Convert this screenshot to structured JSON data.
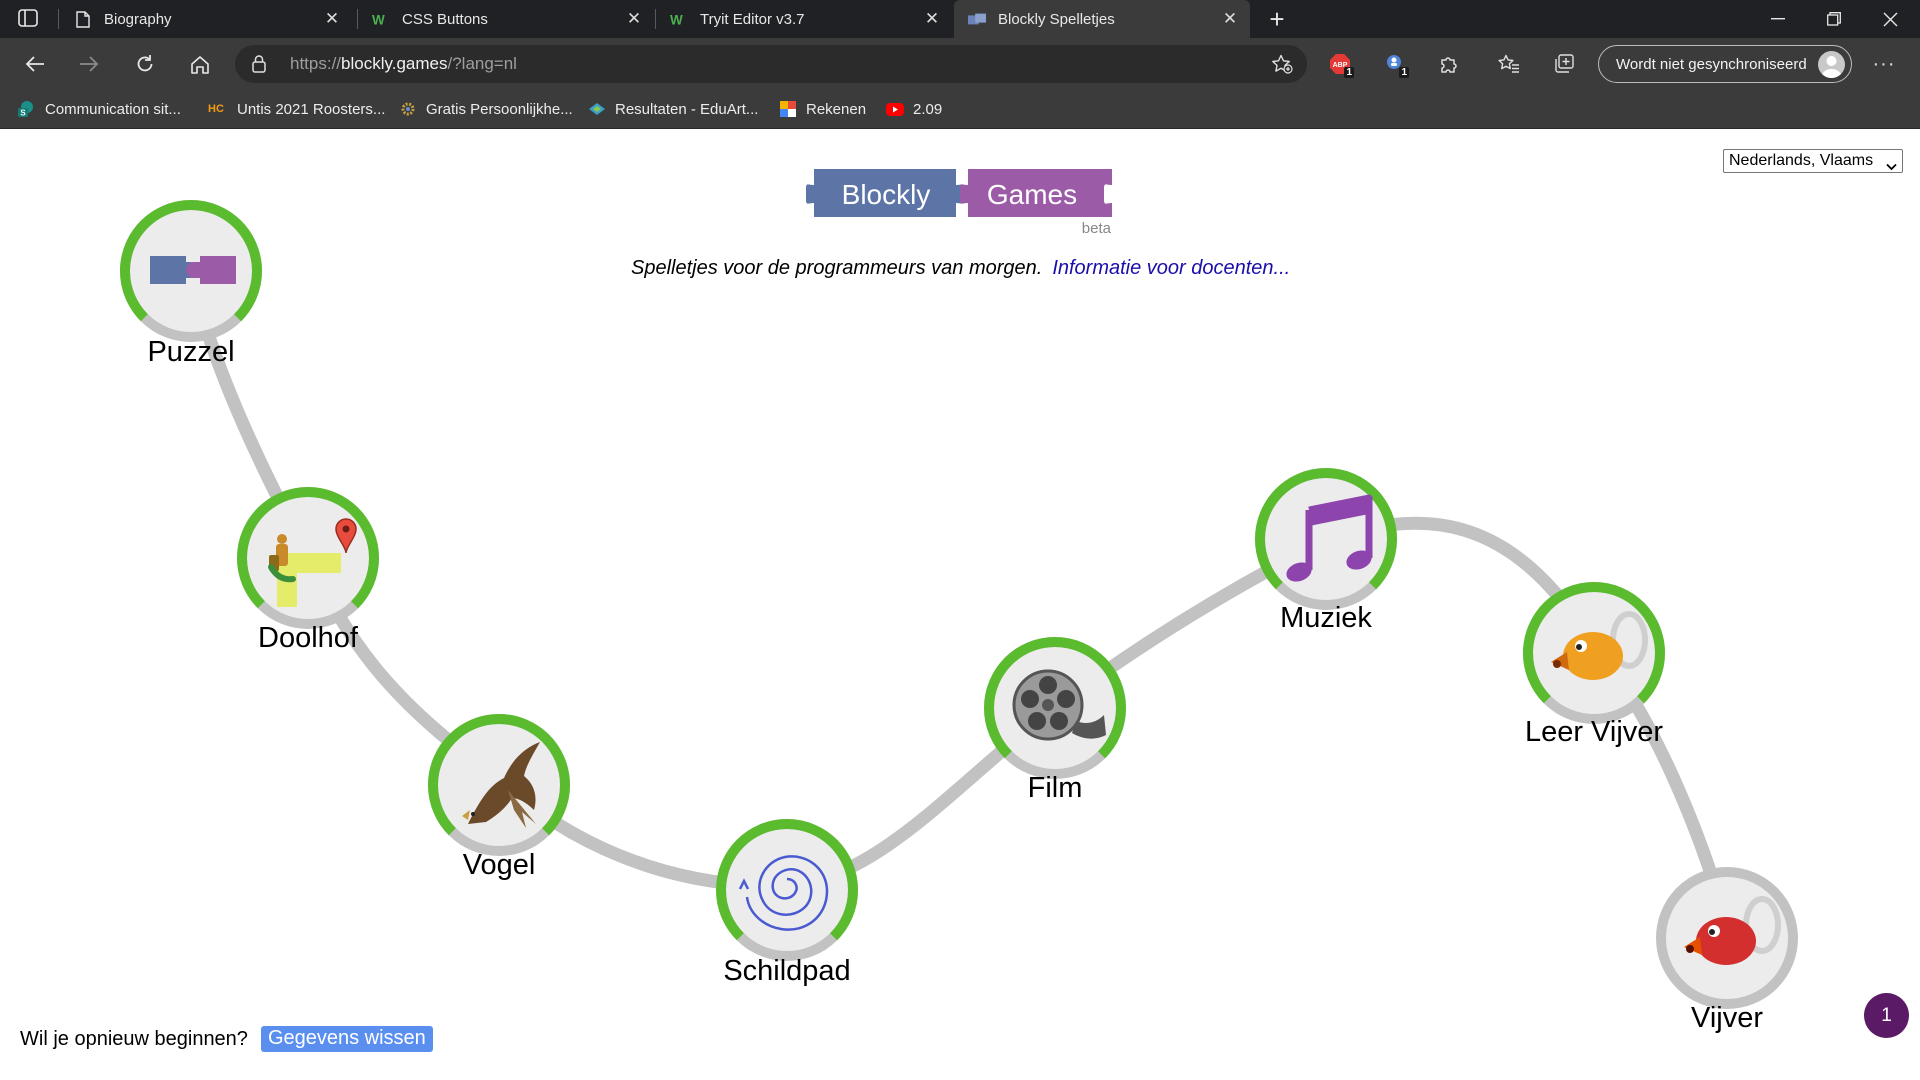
{
  "browser": {
    "tabs": [
      {
        "title": "Biography",
        "favicon": "page-icon"
      },
      {
        "title": "CSS Buttons",
        "favicon": "w3schools-icon"
      },
      {
        "title": "Tryit Editor v3.7",
        "favicon": "w3schools-icon"
      },
      {
        "title": "Blockly Spelletjes",
        "favicon": "blockly-icon",
        "active": true
      }
    ],
    "url_scheme": "https://",
    "url_host": "blockly.games",
    "url_path": "/?lang=nl",
    "extensions": [
      {
        "name": "adblock-icon",
        "badge": "1"
      },
      {
        "name": "extension-blue-icon",
        "badge": "1"
      }
    ],
    "sync_label": "Wordt niet gesynchroniseerd",
    "bookmarks": [
      {
        "label": "Communication sit...",
        "icon": "S"
      },
      {
        "label": "Untis 2021 Roosters...",
        "icon": "HC"
      },
      {
        "label": "Gratis Persoonlijkhe...",
        "icon": "gear"
      },
      {
        "label": "Resultaten - EduArt...",
        "icon": "eduarte"
      },
      {
        "label": "Rekenen",
        "icon": "rekenen"
      },
      {
        "label": "2.09",
        "icon": "youtube"
      }
    ]
  },
  "page": {
    "language": "Nederlands, Vlaams",
    "logo": {
      "left": "Blockly",
      "right": "Games",
      "sub": "beta"
    },
    "tagline": "Spelletjes voor de programmeurs van morgen.",
    "teacher_link": "Informatie voor docenten...",
    "levels": [
      {
        "name": "Puzzel",
        "icon": "puzzle-icon",
        "progress": 0.75
      },
      {
        "name": "Doolhof",
        "icon": "maze-icon",
        "progress": 0.75
      },
      {
        "name": "Vogel",
        "icon": "bird-icon",
        "progress": 0.75
      },
      {
        "name": "Schildpad",
        "icon": "turtle-spiral-icon",
        "progress": 0.75
      },
      {
        "name": "Film",
        "icon": "film-reel-icon",
        "progress": 0.75
      },
      {
        "name": "Muziek",
        "icon": "music-note-icon",
        "progress": 0.75
      },
      {
        "name": "Leer Vijver",
        "icon": "duck-orange-icon",
        "progress": 0.75
      },
      {
        "name": "Vijver",
        "icon": "duck-red-icon",
        "progress": 0
      }
    ],
    "restart_text": "Wil je opnieuw beginnen?",
    "clear_button": "Gegevens wissen",
    "notification_count": "1",
    "colors": {
      "progress_green": "#5bbb2e",
      "track_gray": "#c2c2c2",
      "logo_blue": "#5c75a6",
      "logo_purple": "#9b5ba6",
      "link_blue": "#1a0dab",
      "clear_button": "#5a8ff0",
      "notif_purple": "#5b1a66"
    }
  }
}
